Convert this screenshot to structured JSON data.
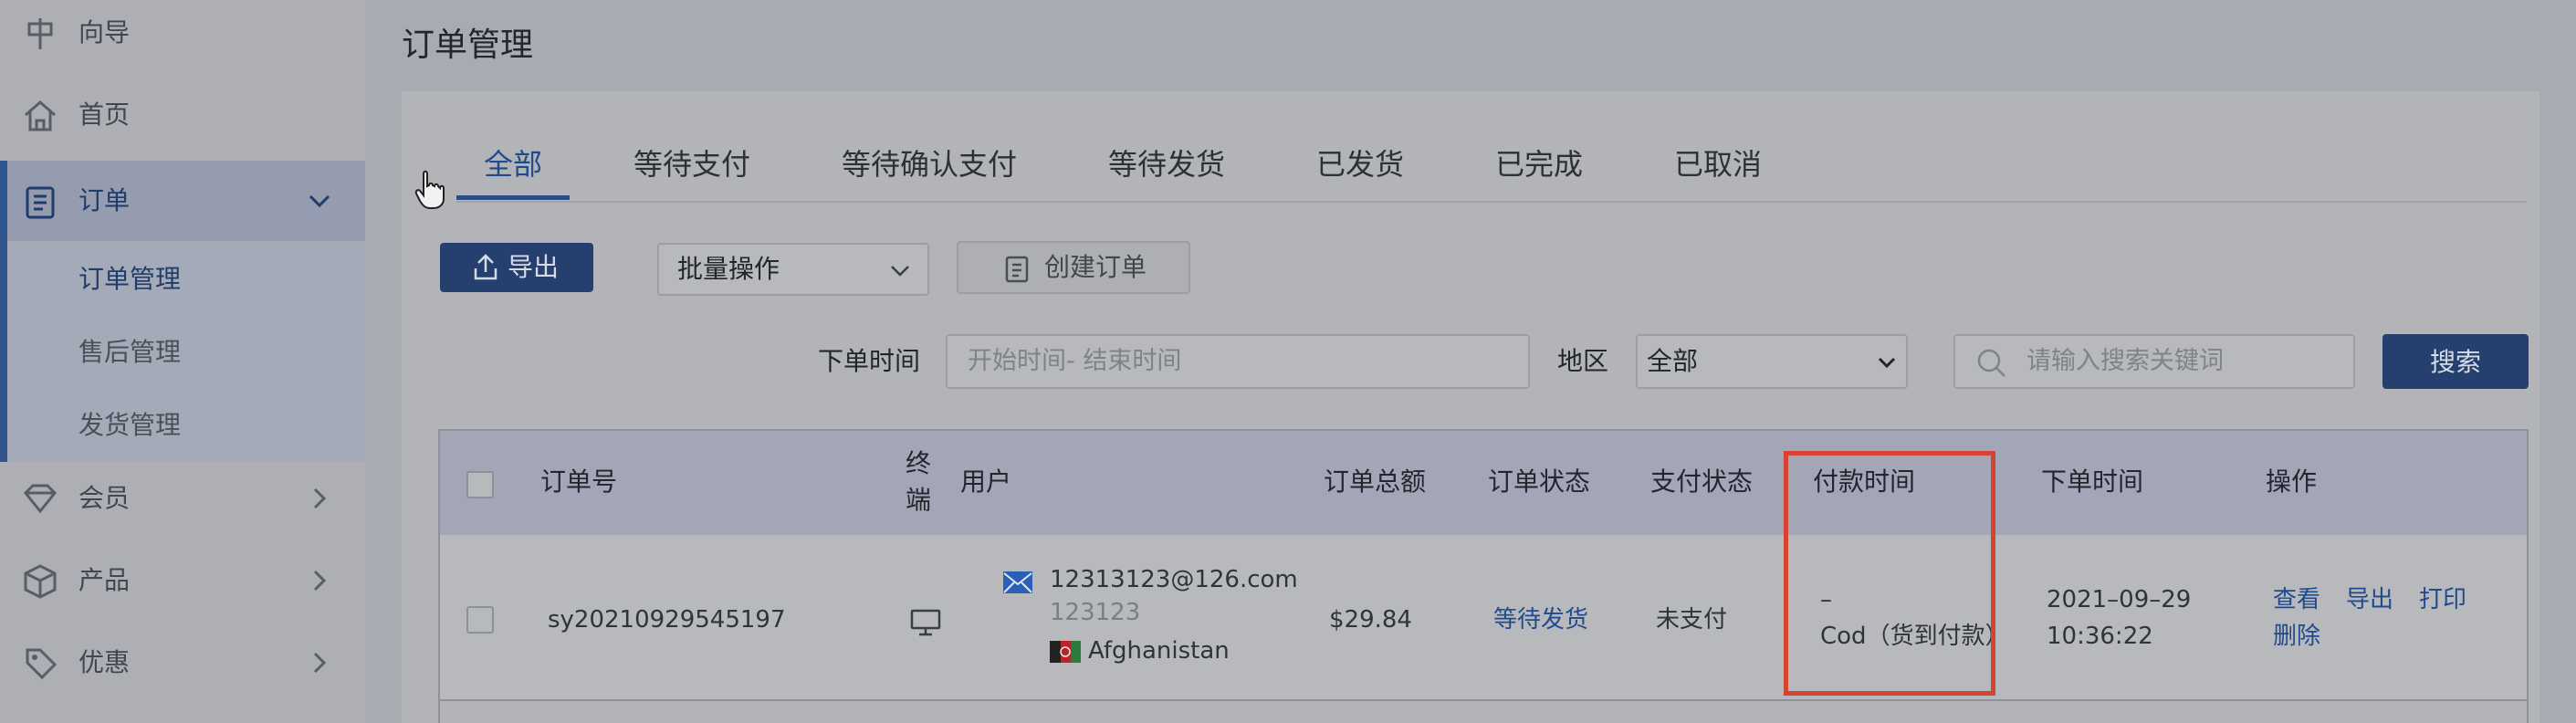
{
  "sidebar": {
    "items": [
      {
        "label": "向导",
        "icon": "signpost-icon"
      },
      {
        "label": "首页",
        "icon": "home-icon"
      },
      {
        "label": "订单",
        "icon": "clipboard-icon"
      },
      {
        "label": "会员",
        "icon": "diamond-icon"
      },
      {
        "label": "产品",
        "icon": "box-icon"
      },
      {
        "label": "优惠",
        "icon": "tag-icon"
      }
    ],
    "order_submenu": [
      "订单管理",
      "售后管理",
      "发货管理"
    ]
  },
  "page": {
    "title": "订单管理"
  },
  "tabs": [
    "全部",
    "等待支付",
    "等待确认支付",
    "等待发货",
    "已发货",
    "已完成",
    "已取消"
  ],
  "toolbar": {
    "export_label": "导出",
    "batch_select": "批量操作",
    "create_label": "创建订单"
  },
  "filters": {
    "order_time_label": "下单时间",
    "date_placeholder": "开始时间- 结束时间",
    "region_label": "地区",
    "region_value": "全部",
    "search_placeholder": "请输入搜索关键词",
    "search_button": "搜索"
  },
  "table": {
    "headers": {
      "order_no": "订单号",
      "terminal_1": "终",
      "terminal_2": "端",
      "user": "用户",
      "total": "订单总额",
      "order_status": "订单状态",
      "pay_status": "支付状态",
      "pay_time": "付款时间",
      "order_time": "下单时间",
      "actions": "操作"
    },
    "rows": [
      {
        "order_no": "sy20210929545197",
        "terminal_icon": "desktop-icon",
        "email": "12313123@126.com",
        "user_name": "123123",
        "country": "Afghanistan",
        "total": "$29.84",
        "order_status": "等待发货",
        "pay_status": "未支付",
        "pay_time": "–",
        "pay_method": "Cod（货到付款）",
        "order_date": "2021–09–29",
        "order_clock": "10:36:22",
        "actions": {
          "view": "查看",
          "export": "导出",
          "print": "打印",
          "delete": "删除"
        }
      }
    ]
  },
  "colors": {
    "accent": "#253f6e",
    "link": "#1f4b8e",
    "highlight_box": "#d6442f"
  }
}
